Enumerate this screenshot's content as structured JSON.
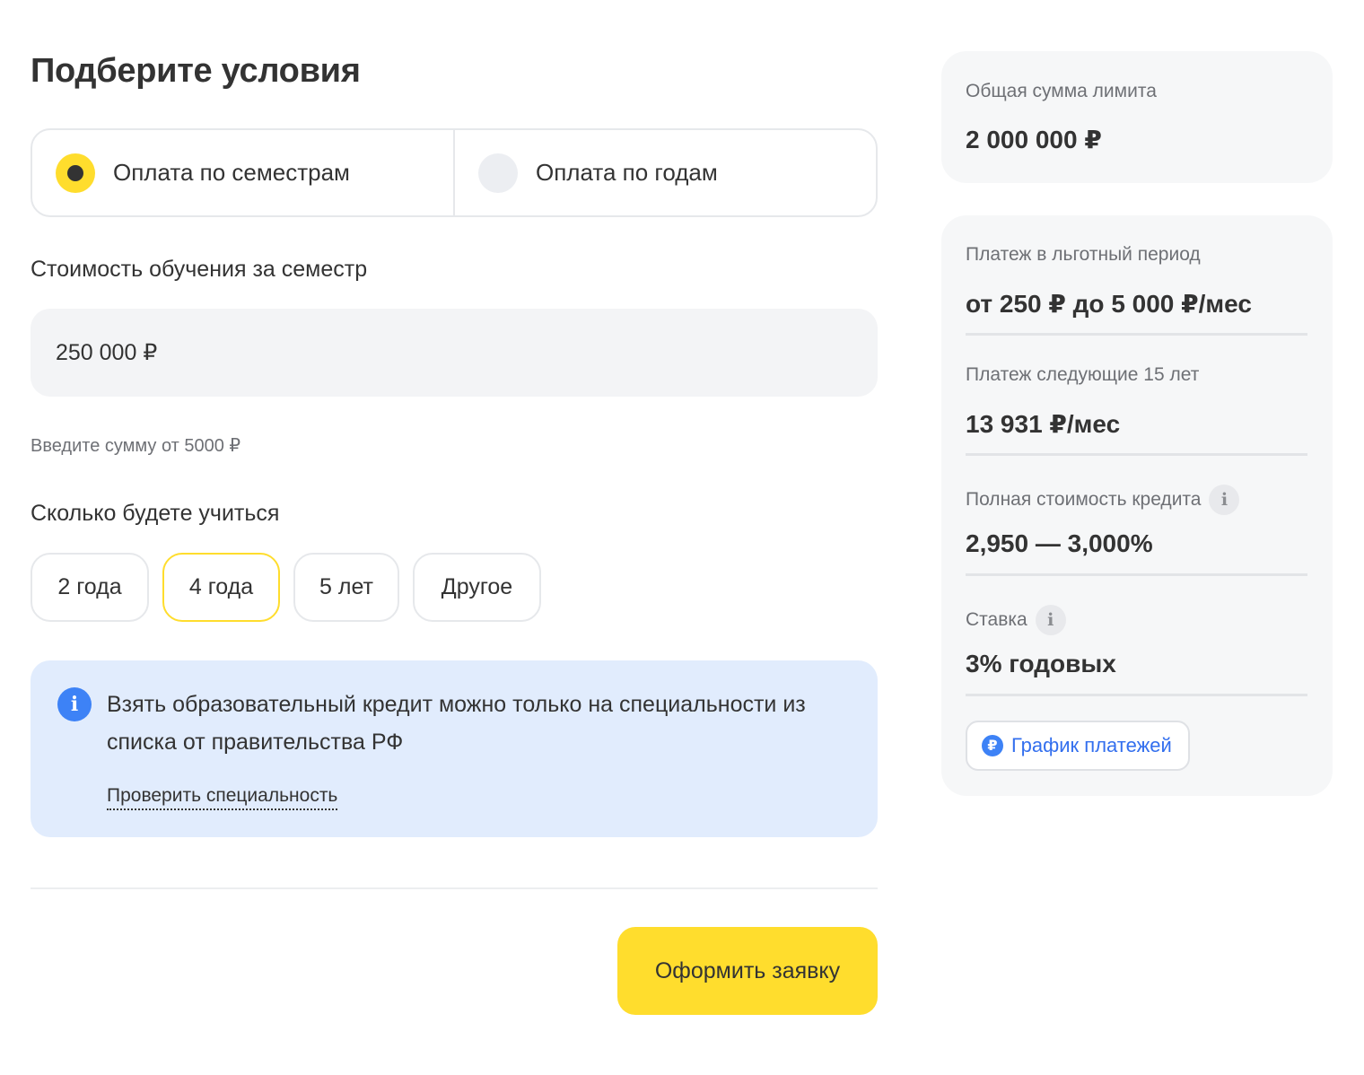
{
  "page_title": "Подберите условия",
  "payment_modes": [
    {
      "label": "Оплата по семестрам",
      "checked": true
    },
    {
      "label": "Оплата по годам",
      "checked": false
    }
  ],
  "cost": {
    "label": "Стоимость обучения за семестр",
    "value": "250 000 ₽",
    "hint": "Введите сумму от 5000 ₽"
  },
  "duration": {
    "label": "Сколько будете учиться",
    "options": [
      "2 года",
      "4 года",
      "5 лет",
      "Другое"
    ],
    "selected": "4 года"
  },
  "info": {
    "text": "Взять образовательный кредит можно только на специальности из списка от правительства РФ",
    "link": "Проверить специальность",
    "icon": "info-icon"
  },
  "submit_label": "Оформить заявку",
  "limit": {
    "label": "Общая сумма лимита",
    "value": "2 000 000 ₽"
  },
  "summary": [
    {
      "label": "Платеж в льготный период",
      "value": "от 250 ₽ до 5 000 ₽/мес",
      "info": false
    },
    {
      "label": "Платеж следующие 15 лет",
      "value": "13 931 ₽/мес",
      "info": false
    },
    {
      "label": "Полная стоимость кредита",
      "value": "2,950 — 3,000%",
      "info": true
    },
    {
      "label": "Ставка",
      "value": "3% годовых",
      "info": true
    }
  ],
  "schedule_button": {
    "label": "График платежей",
    "icon_glyph": "₽"
  },
  "colors": {
    "accent_yellow": "#ffdd2d",
    "info_bg": "#e1ecfd",
    "link_blue": "#336fee",
    "card_bg": "#f6f7f8"
  }
}
